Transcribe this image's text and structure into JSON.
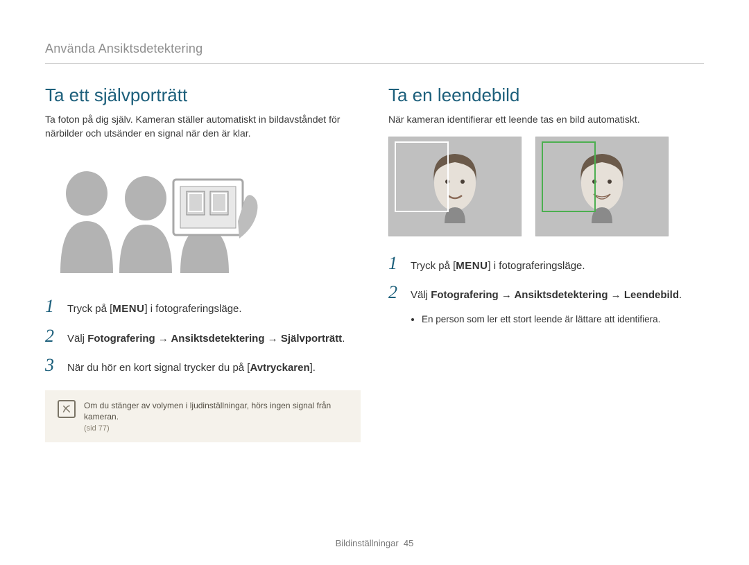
{
  "section_header": "Använda Ansiktsdetektering",
  "left": {
    "title": "Ta ett självporträtt",
    "intro": "Ta foton på dig själv. Kameran ställer automatiskt in bildavståndet för närbilder och utsänder en signal när den är klar.",
    "steps": [
      {
        "num": "1",
        "pre": "Tryck på [",
        "menu": "MENU",
        "post": "] i fotograferingsläge."
      },
      {
        "num": "2",
        "text_pre": "Välj ",
        "bold": "Fotografering → Ansiktsdetektering → Självporträtt",
        "text_post": "."
      },
      {
        "num": "3",
        "text_pre": "När du hör en kort signal trycker du på [",
        "bold": "Avtryckaren",
        "text_post": "]."
      }
    ],
    "note": "Om du stänger av volymen i ljudinställningar, hörs ingen signal från kameran.",
    "note_ref": "(sid 77)"
  },
  "right": {
    "title": "Ta en leendebild",
    "intro": "När kameran identifierar ett leende tas en bild automatiskt.",
    "steps": [
      {
        "num": "1",
        "pre": "Tryck på [",
        "menu": "MENU",
        "post": "] i fotograferingsläge."
      },
      {
        "num": "2",
        "text_pre": "Välj ",
        "bold": "Fotografering → Ansiktsdetektering → Leendebild",
        "text_post": "."
      }
    ],
    "sub_bullet": "En person som ler ett stort leende är lättare att identifiera."
  },
  "footer": {
    "label": "Bildinställningar",
    "page": "45"
  }
}
